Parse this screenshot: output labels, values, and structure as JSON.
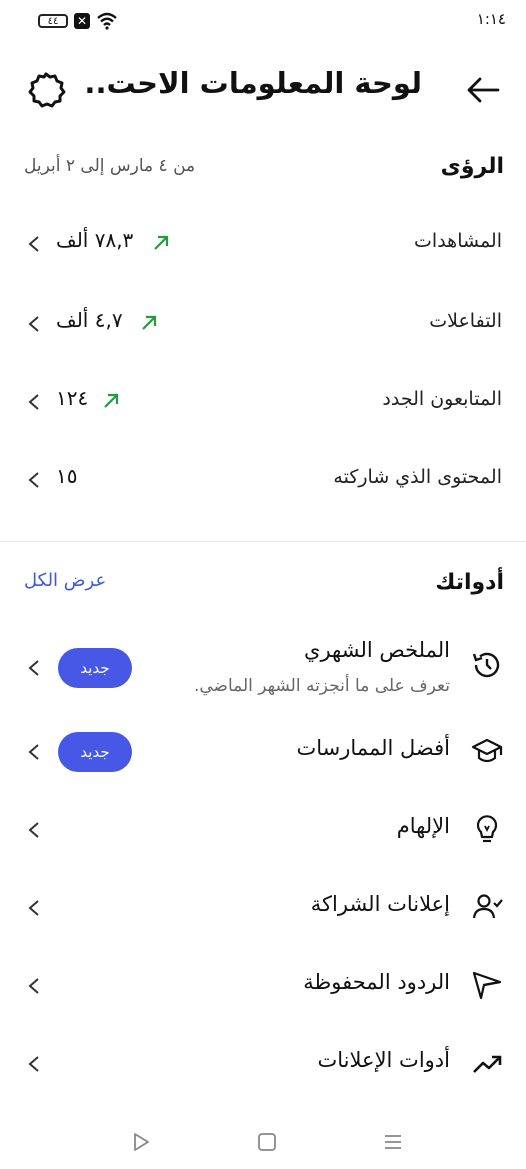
{
  "status": {
    "time": "١:١٤",
    "battery": "٤٤"
  },
  "header": {
    "title": "لوحة المعلومات الاحت.."
  },
  "insights": {
    "title": "الرؤى",
    "date_range": "من ٤ مارس إلى ٢ أبريل",
    "metrics": [
      {
        "label": "المشاهدات",
        "value": "٧٨,٣ ألف",
        "trend": "up"
      },
      {
        "label": "التفاعلات",
        "value": "٤,٧ ألف",
        "trend": "up"
      },
      {
        "label": "المتابعون الجدد",
        "value": "١٢٤",
        "trend": "up"
      },
      {
        "label": "المحتوى الذي شاركته",
        "value": "١٥",
        "trend": "none"
      }
    ]
  },
  "tools": {
    "title": "أدواتك",
    "view_all": "عرض الكل",
    "items": [
      {
        "label": "الملخص الشهري",
        "subtitle": "تعرف على ما أنجزته الشهر الماضي.",
        "badge": "جديد",
        "icon": "history-icon"
      },
      {
        "label": "أفضل الممارسات",
        "badge": "جديد",
        "icon": "graduation-cap-icon"
      },
      {
        "label": "الإلهام",
        "icon": "lightbulb-icon"
      },
      {
        "label": "إعلانات الشراكة",
        "icon": "person-check-icon"
      },
      {
        "label": "الردود المحفوظة",
        "icon": "send-icon"
      },
      {
        "label": "أدوات الإعلانات",
        "icon": "trending-up-icon"
      }
    ]
  },
  "colors": {
    "accent": "#3b5bdb",
    "badge": "#4757e6",
    "trend": "#1f9d3a"
  }
}
